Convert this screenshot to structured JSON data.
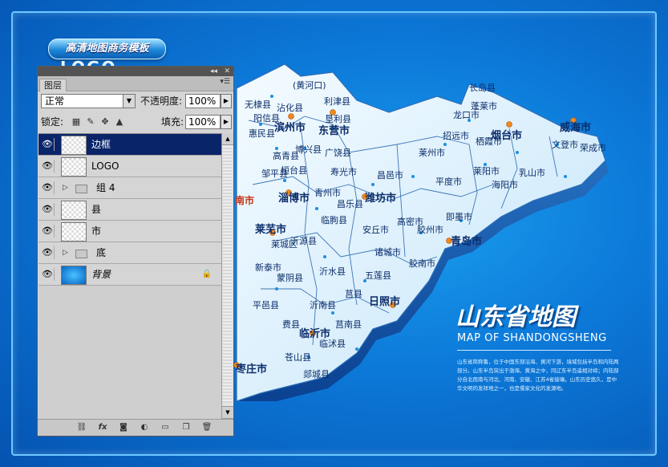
{
  "poster": {
    "banner": "高清地图商务模板",
    "logo_text": "LOGO",
    "title_cn": "山东省地图",
    "title_en": "MAP OF SHANDONGSHENG",
    "description": "山东省简称鲁，位于中国东部沿海、黄河下游，境域包括半岛和内陆两部分。山东半岛突出于渤海、黄海之中，同辽东半岛遥相对峙；内陆部分自北而南与河北、河南、安徽、江苏4省接壤。山东历史悠久，是中华文明的发祥地之一，也是儒家文化的发源地。"
  },
  "map": {
    "cities": [
      {
        "name": "东营市",
        "type": "big"
      },
      {
        "name": "滨州市",
        "type": "big"
      },
      {
        "name": "烟台市",
        "type": "big"
      },
      {
        "name": "威海市",
        "type": "big"
      },
      {
        "name": "淄博市",
        "type": "big"
      },
      {
        "name": "潍坊市",
        "type": "big"
      },
      {
        "name": "莱芜市",
        "type": "big"
      },
      {
        "name": "青岛市",
        "type": "big"
      },
      {
        "name": "日照市",
        "type": "big"
      },
      {
        "name": "临沂市",
        "type": "big"
      },
      {
        "name": "枣庄市",
        "type": "big"
      },
      {
        "name": "南市",
        "type": "red"
      },
      {
        "name": "长岛县",
        "type": "small"
      },
      {
        "name": "龙口市",
        "type": "small"
      },
      {
        "name": "蓬莱市",
        "type": "small"
      },
      {
        "name": "招远市",
        "type": "small"
      },
      {
        "name": "栖霞市",
        "type": "small"
      },
      {
        "name": "莱阳市",
        "type": "small"
      },
      {
        "name": "海阳市",
        "type": "small"
      },
      {
        "name": "乳山市",
        "type": "small"
      },
      {
        "name": "文登市",
        "type": "small"
      },
      {
        "name": "荣成市",
        "type": "small"
      },
      {
        "name": "莱州市",
        "type": "small"
      },
      {
        "name": "平度市",
        "type": "small"
      },
      {
        "name": "即墨市",
        "type": "small"
      },
      {
        "name": "胶南市",
        "type": "small"
      },
      {
        "name": "胶州市",
        "type": "small"
      },
      {
        "name": "高密市",
        "type": "small"
      },
      {
        "name": "诸城市",
        "type": "small"
      },
      {
        "name": "安丘市",
        "type": "small"
      },
      {
        "name": "昌邑市",
        "type": "small"
      },
      {
        "name": "寿光市",
        "type": "small"
      },
      {
        "name": "青州市",
        "type": "small"
      },
      {
        "name": "昌乐县",
        "type": "small"
      },
      {
        "name": "临朐县",
        "type": "small"
      },
      {
        "name": "沂源县",
        "type": "small"
      },
      {
        "name": "沂水县",
        "type": "small"
      },
      {
        "name": "莒县",
        "type": "small"
      },
      {
        "name": "五莲县",
        "type": "small"
      },
      {
        "name": "沂南县",
        "type": "small"
      },
      {
        "name": "蒙阴县",
        "type": "small"
      },
      {
        "name": "平邑县",
        "type": "small"
      },
      {
        "name": "费县",
        "type": "small"
      },
      {
        "name": "莒南县",
        "type": "small"
      },
      {
        "name": "临沭县",
        "type": "small"
      },
      {
        "name": "郯城县",
        "type": "small"
      },
      {
        "name": "苍山县",
        "type": "small"
      },
      {
        "name": "广饶县",
        "type": "small"
      },
      {
        "name": "利津县",
        "type": "small"
      },
      {
        "name": "垦利县",
        "type": "small"
      },
      {
        "name": "沾化县",
        "type": "small"
      },
      {
        "name": "无棣县",
        "type": "small"
      },
      {
        "name": "阳信县",
        "type": "small"
      },
      {
        "name": "惠民县",
        "type": "small"
      },
      {
        "name": "博兴县",
        "type": "small"
      },
      {
        "name": "高青县",
        "type": "small"
      },
      {
        "name": "桓台县",
        "type": "small"
      },
      {
        "name": "邹平县",
        "type": "small"
      },
      {
        "name": "新泰市",
        "type": "small"
      },
      {
        "name": "莱城区",
        "type": "small"
      },
      {
        "name": "(黄河口)",
        "type": "small"
      }
    ]
  },
  "panel": {
    "tab": "图层",
    "blend_mode": "正常",
    "opacity_label": "不透明度:",
    "opacity_value": "100%",
    "lock_label": "锁定:",
    "fill_label": "填充:",
    "fill_value": "100%",
    "layers": [
      {
        "name": "边框",
        "kind": "layer",
        "selected": true
      },
      {
        "name": "LOGO",
        "kind": "layer",
        "selected": false
      },
      {
        "name": "组 4",
        "kind": "group",
        "selected": false
      },
      {
        "name": "县",
        "kind": "layer",
        "selected": false
      },
      {
        "name": "市",
        "kind": "layer",
        "selected": false
      },
      {
        "name": "底",
        "kind": "group",
        "selected": false
      },
      {
        "name": "背景",
        "kind": "background",
        "selected": false
      }
    ]
  },
  "icons": {
    "eye": "eye-icon",
    "link": "link-icon",
    "fx": "fx-icon",
    "mask": "mask-icon",
    "adjustment": "adjustment-icon",
    "new_group": "folder-icon",
    "new_layer": "new-layer-icon",
    "delete": "trash-icon"
  }
}
